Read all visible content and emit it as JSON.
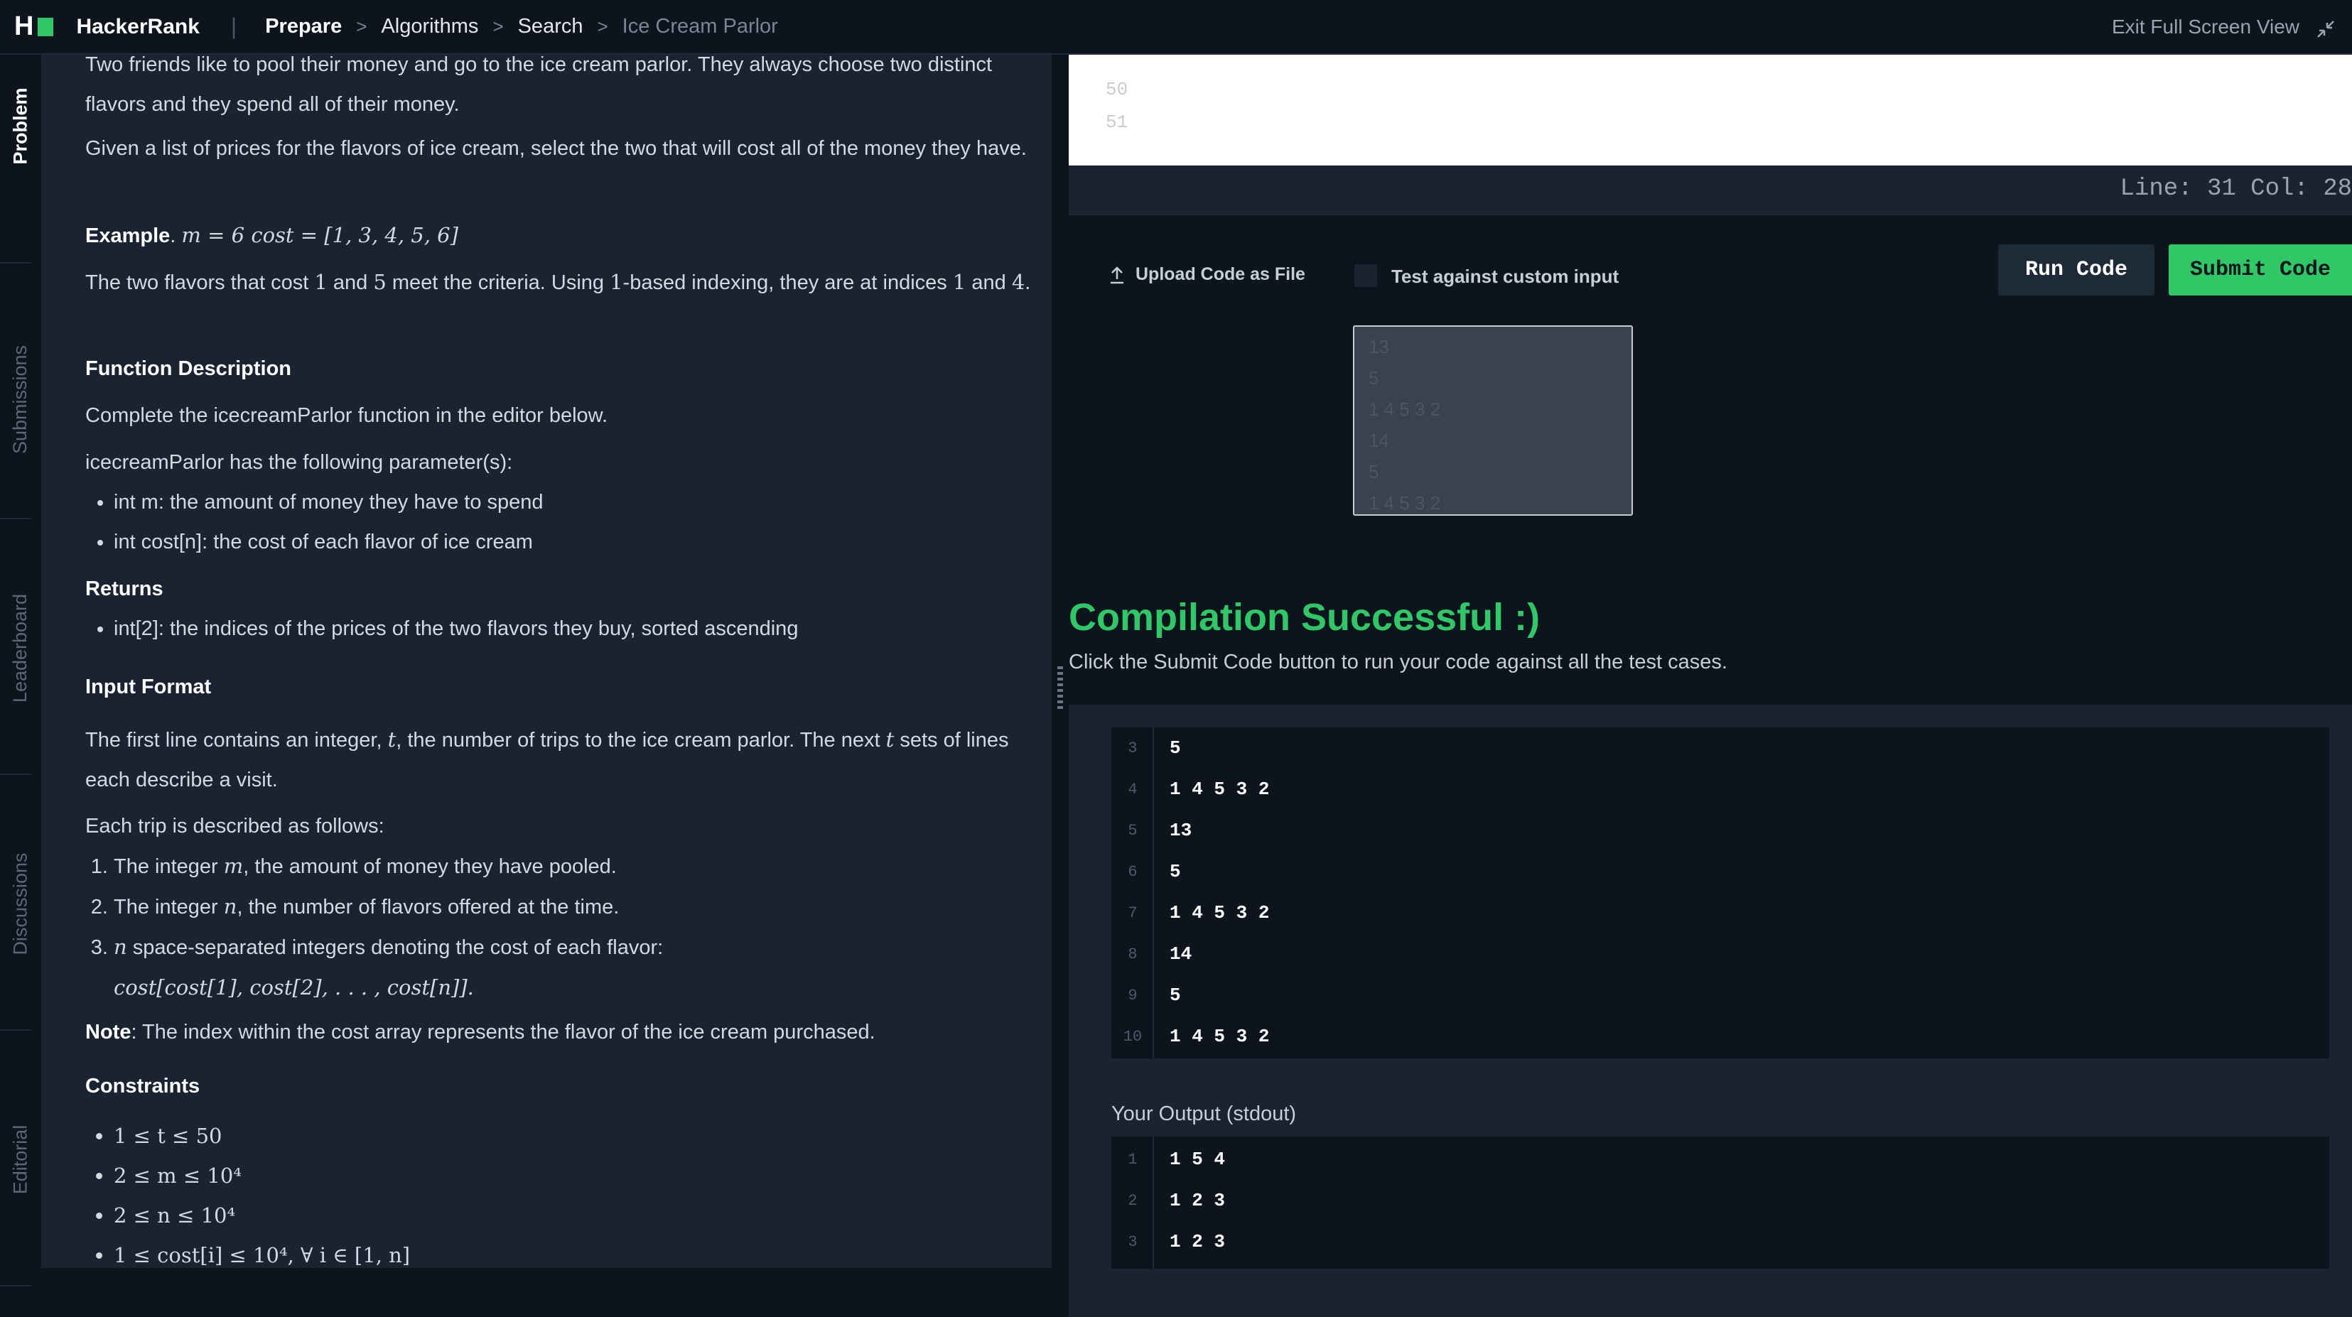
{
  "topbar": {
    "brand": "HackerRank",
    "breadcrumbs": [
      "Prepare",
      "Algorithms",
      "Search",
      "Ice Cream Parlor"
    ],
    "exit_label": "Exit Full Screen View"
  },
  "side_tabs": [
    "Problem",
    "Submissions",
    "Leaderboard",
    "Discussions",
    "Editorial"
  ],
  "problem": {
    "intro_1": "Two friends like to pool their money and go to the ice cream parlor. They always choose two distinct flavors and they spend all of their money.",
    "intro_2": "Given a list of prices for the flavors of ice cream, select the two that will cost all of the money they have.",
    "example_label": "Example",
    "example_math": "m = 6 cost = [1, 3, 4, 5, 6]",
    "example_text_1": "The two flavors that cost",
    "example_text_and": "and",
    "example_text_2": "meet the criteria. Using",
    "example_text_3": "-based indexing, they are at indices",
    "val_1": "1",
    "val_5": "5",
    "val_4": "4",
    "func_desc_heading": "Function Description",
    "func_desc": "Complete the icecreamParlor function in the editor below.",
    "params_intro": "icecreamParlor has the following parameter(s):",
    "params": [
      "int m: the amount of money they have to spend",
      "int cost[n]: the cost of each flavor of ice cream"
    ],
    "returns_heading": "Returns",
    "returns": [
      "int[2]: the indices of the prices of the two flavors they buy, sorted ascending"
    ],
    "input_heading": "Input Format",
    "input_1a": "The first line contains an integer,",
    "input_1b": ", the number of trips to the ice cream parlor. The next",
    "input_1c": "sets of lines each describe a visit.",
    "var_t": "t",
    "trip_intro": "Each trip is described as follows:",
    "trip_1": "The integer",
    "trip_1b": ", the amount of money they have pooled.",
    "trip_2": "The integer",
    "trip_2b": ", the number of flavors offered at the time.",
    "trip_3b": "space-separated integers denoting the cost of each flavor:",
    "trip_3_math": "cost[cost[1], cost[2], . . . , cost[n]].",
    "var_m": "m",
    "var_n": "n",
    "note_label": "Note",
    "note_text": ": The index within the cost array represents the flavor of the ice cream purchased.",
    "constraints_heading": "Constraints",
    "constraints": [
      "1 ≤ t ≤ 50",
      "2 ≤ m ≤ 10⁴",
      "2 ≤ n ≤ 10⁴",
      "1 ≤ cost[i] ≤ 10⁴, ∀ i ∈ [1, n]"
    ]
  },
  "editor": {
    "line_numbers": [
      "50",
      "51"
    ],
    "status": "Line: 31 Col: 28"
  },
  "actions": {
    "upload_label": "Upload Code as File",
    "custom_input_label": "Test against custom input",
    "run_label": "Run Code",
    "submit_label": "Submit Code"
  },
  "custom_input_text": "13\n5\n1 4 5 3 2\n14\n5\n1 4 5 3 2",
  "compile": {
    "title": "Compilation Successful :)",
    "subtitle": "Click the Submit Code button to run your code against all the test cases."
  },
  "input_rows": [
    {
      "n": "3",
      "v": "5"
    },
    {
      "n": "4",
      "v": "1 4 5 3 2"
    },
    {
      "n": "5",
      "v": "13"
    },
    {
      "n": "6",
      "v": "5"
    },
    {
      "n": "7",
      "v": "1 4 5 3 2"
    },
    {
      "n": "8",
      "v": "14"
    },
    {
      "n": "9",
      "v": "5"
    },
    {
      "n": "10",
      "v": "1 4 5 3 2"
    }
  ],
  "output_label": "Your Output (stdout)",
  "output_rows": [
    {
      "n": "1",
      "v": "1 5 4"
    },
    {
      "n": "2",
      "v": "1 2 3"
    },
    {
      "n": "3",
      "v": "1 2 3"
    }
  ],
  "colors": {
    "accent": "#2ec866",
    "bg": "#0e141e",
    "panel": "#1a2332"
  }
}
